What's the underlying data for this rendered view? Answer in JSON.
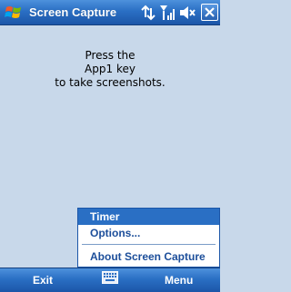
{
  "titlebar": {
    "title": "Screen Capture",
    "icons": [
      "windows-start-icon",
      "connectivity-icon",
      "signal-icon",
      "volume-icon",
      "close-icon"
    ]
  },
  "content": {
    "message_lines": [
      "Press the",
      "App1 key",
      "to take screenshots."
    ]
  },
  "menu": {
    "items": [
      {
        "label": "Timer",
        "selected": true
      },
      {
        "label": "Options..."
      },
      {
        "label": "About Screen Capture"
      }
    ]
  },
  "softkeys": {
    "left": "Exit",
    "right": "Menu",
    "center_icon": "keyboard-icon"
  },
  "colors": {
    "titlebar": "#2a6fc4",
    "background": "#c8d8ea",
    "menu_text": "#1c4e9a",
    "menu_selected": "#2a6fc4"
  }
}
